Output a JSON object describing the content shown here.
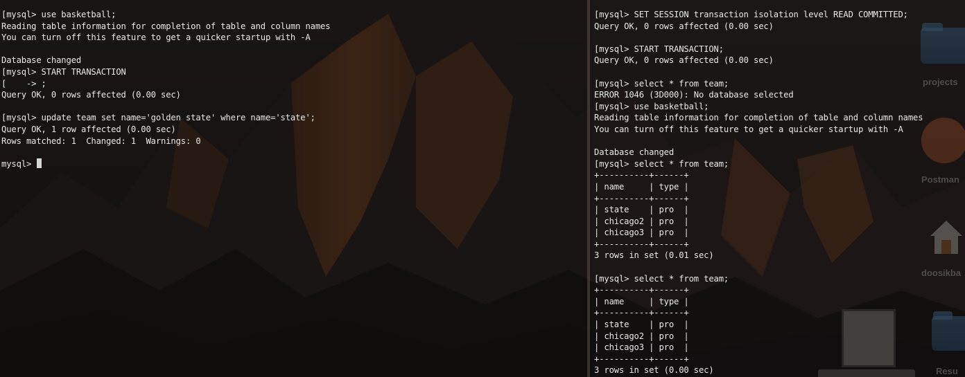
{
  "left_terminal": {
    "lines": [
      "[mysql> use basketball;",
      "Reading table information for completion of table and column names",
      "You can turn off this feature to get a quicker startup with -A",
      "",
      "Database changed",
      "[mysql> START TRANSACTION",
      "[    -> ;",
      "Query OK, 0 rows affected (0.00 sec)",
      "",
      "[mysql> update team set name='golden state' where name='state';",
      "Query OK, 1 row affected (0.00 sec)",
      "Rows matched: 1  Changed: 1  Warnings: 0",
      "",
      "mysql> "
    ]
  },
  "right_terminal": {
    "lines": [
      "[mysql> SET SESSION transaction isolation level READ COMMITTED;",
      "Query OK, 0 rows affected (0.00 sec)",
      "",
      "[mysql> START TRANSACTION;",
      "Query OK, 0 rows affected (0.00 sec)",
      "",
      "[mysql> select * from team;",
      "ERROR 1046 (3D000): No database selected",
      "[mysql> use basketball;",
      "Reading table information for completion of table and column names",
      "You can turn off this feature to get a quicker startup with -A",
      "",
      "Database changed",
      "[mysql> select * from team;",
      "+----------+------+",
      "| name     | type |",
      "+----------+------+",
      "| state    | pro  |",
      "| chicago2 | pro  |",
      "| chicago3 | pro  |",
      "+----------+------+",
      "3 rows in set (0.01 sec)",
      "",
      "[mysql> select * from team;",
      "+----------+------+",
      "| name     | type |",
      "+----------+------+",
      "| state    | pro  |",
      "| chicago2 | pro  |",
      "| chicago3 | pro  |",
      "+----------+------+",
      "3 rows in set (0.00 sec)"
    ]
  },
  "desktop": {
    "icons": [
      {
        "label": "projects",
        "icon": "folder-icon"
      },
      {
        "label": "Postman",
        "icon": "postman-icon"
      },
      {
        "label": "doosikba",
        "icon": "home-folder-icon"
      },
      {
        "label": "Resu",
        "icon": "folder-icon"
      }
    ]
  },
  "colors": {
    "terminal_text": "#e9e9e9",
    "terminal_bg": "#0a0a0a",
    "folder": "#4a80b8",
    "postman": "#e06a36"
  }
}
